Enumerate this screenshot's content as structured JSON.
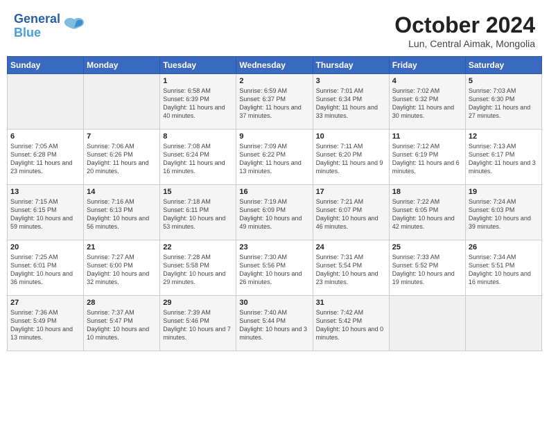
{
  "header": {
    "logo_line1": "General",
    "logo_line2": "Blue",
    "month": "October 2024",
    "location": "Lun, Central Aimak, Mongolia"
  },
  "days_of_week": [
    "Sunday",
    "Monday",
    "Tuesday",
    "Wednesday",
    "Thursday",
    "Friday",
    "Saturday"
  ],
  "weeks": [
    [
      {
        "day": "",
        "detail": ""
      },
      {
        "day": "",
        "detail": ""
      },
      {
        "day": "1",
        "detail": "Sunrise: 6:58 AM\nSunset: 6:39 PM\nDaylight: 11 hours and 40 minutes."
      },
      {
        "day": "2",
        "detail": "Sunrise: 6:59 AM\nSunset: 6:37 PM\nDaylight: 11 hours and 37 minutes."
      },
      {
        "day": "3",
        "detail": "Sunrise: 7:01 AM\nSunset: 6:34 PM\nDaylight: 11 hours and 33 minutes."
      },
      {
        "day": "4",
        "detail": "Sunrise: 7:02 AM\nSunset: 6:32 PM\nDaylight: 11 hours and 30 minutes."
      },
      {
        "day": "5",
        "detail": "Sunrise: 7:03 AM\nSunset: 6:30 PM\nDaylight: 11 hours and 27 minutes."
      }
    ],
    [
      {
        "day": "6",
        "detail": "Sunrise: 7:05 AM\nSunset: 6:28 PM\nDaylight: 11 hours and 23 minutes."
      },
      {
        "day": "7",
        "detail": "Sunrise: 7:06 AM\nSunset: 6:26 PM\nDaylight: 11 hours and 20 minutes."
      },
      {
        "day": "8",
        "detail": "Sunrise: 7:08 AM\nSunset: 6:24 PM\nDaylight: 11 hours and 16 minutes."
      },
      {
        "day": "9",
        "detail": "Sunrise: 7:09 AM\nSunset: 6:22 PM\nDaylight: 11 hours and 13 minutes."
      },
      {
        "day": "10",
        "detail": "Sunrise: 7:11 AM\nSunset: 6:20 PM\nDaylight: 11 hours and 9 minutes."
      },
      {
        "day": "11",
        "detail": "Sunrise: 7:12 AM\nSunset: 6:19 PM\nDaylight: 11 hours and 6 minutes."
      },
      {
        "day": "12",
        "detail": "Sunrise: 7:13 AM\nSunset: 6:17 PM\nDaylight: 11 hours and 3 minutes."
      }
    ],
    [
      {
        "day": "13",
        "detail": "Sunrise: 7:15 AM\nSunset: 6:15 PM\nDaylight: 10 hours and 59 minutes."
      },
      {
        "day": "14",
        "detail": "Sunrise: 7:16 AM\nSunset: 6:13 PM\nDaylight: 10 hours and 56 minutes."
      },
      {
        "day": "15",
        "detail": "Sunrise: 7:18 AM\nSunset: 6:11 PM\nDaylight: 10 hours and 53 minutes."
      },
      {
        "day": "16",
        "detail": "Sunrise: 7:19 AM\nSunset: 6:09 PM\nDaylight: 10 hours and 49 minutes."
      },
      {
        "day": "17",
        "detail": "Sunrise: 7:21 AM\nSunset: 6:07 PM\nDaylight: 10 hours and 46 minutes."
      },
      {
        "day": "18",
        "detail": "Sunrise: 7:22 AM\nSunset: 6:05 PM\nDaylight: 10 hours and 42 minutes."
      },
      {
        "day": "19",
        "detail": "Sunrise: 7:24 AM\nSunset: 6:03 PM\nDaylight: 10 hours and 39 minutes."
      }
    ],
    [
      {
        "day": "20",
        "detail": "Sunrise: 7:25 AM\nSunset: 6:01 PM\nDaylight: 10 hours and 36 minutes."
      },
      {
        "day": "21",
        "detail": "Sunrise: 7:27 AM\nSunset: 6:00 PM\nDaylight: 10 hours and 32 minutes."
      },
      {
        "day": "22",
        "detail": "Sunrise: 7:28 AM\nSunset: 5:58 PM\nDaylight: 10 hours and 29 minutes."
      },
      {
        "day": "23",
        "detail": "Sunrise: 7:30 AM\nSunset: 5:56 PM\nDaylight: 10 hours and 26 minutes."
      },
      {
        "day": "24",
        "detail": "Sunrise: 7:31 AM\nSunset: 5:54 PM\nDaylight: 10 hours and 23 minutes."
      },
      {
        "day": "25",
        "detail": "Sunrise: 7:33 AM\nSunset: 5:52 PM\nDaylight: 10 hours and 19 minutes."
      },
      {
        "day": "26",
        "detail": "Sunrise: 7:34 AM\nSunset: 5:51 PM\nDaylight: 10 hours and 16 minutes."
      }
    ],
    [
      {
        "day": "27",
        "detail": "Sunrise: 7:36 AM\nSunset: 5:49 PM\nDaylight: 10 hours and 13 minutes."
      },
      {
        "day": "28",
        "detail": "Sunrise: 7:37 AM\nSunset: 5:47 PM\nDaylight: 10 hours and 10 minutes."
      },
      {
        "day": "29",
        "detail": "Sunrise: 7:39 AM\nSunset: 5:46 PM\nDaylight: 10 hours and 7 minutes."
      },
      {
        "day": "30",
        "detail": "Sunrise: 7:40 AM\nSunset: 5:44 PM\nDaylight: 10 hours and 3 minutes."
      },
      {
        "day": "31",
        "detail": "Sunrise: 7:42 AM\nSunset: 5:42 PM\nDaylight: 10 hours and 0 minutes."
      },
      {
        "day": "",
        "detail": ""
      },
      {
        "day": "",
        "detail": ""
      }
    ]
  ]
}
